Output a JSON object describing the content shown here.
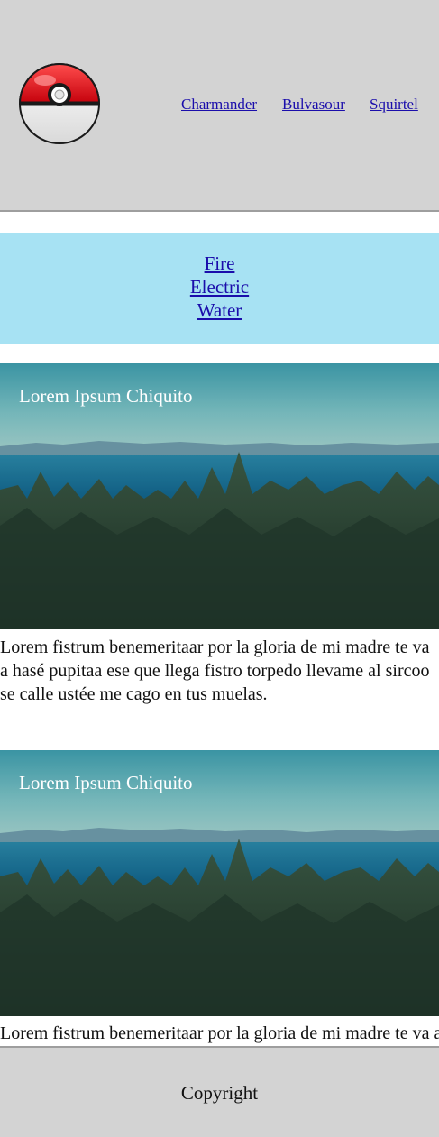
{
  "header": {
    "logo_icon": "pokeball-icon",
    "nav": [
      {
        "label": "Charmander"
      },
      {
        "label": "Bulvasour"
      },
      {
        "label": "Squirtel"
      }
    ]
  },
  "categories": [
    {
      "label": "Fire"
    },
    {
      "label": "Electric"
    },
    {
      "label": "Water"
    }
  ],
  "articles": [
    {
      "caption": "Lorem Ipsum Chiquito",
      "text": "Lorem fistrum benemeritaar por la gloria de mi madre te va a hasé pupitaa ese que llega fistro torpedo llevame al sircoo se calle ustée me cago en tus muelas."
    },
    {
      "caption": "Lorem Ipsum Chiquito",
      "text": "Lorem fistrum benemeritaar por la gloria de mi madre te va a hasé pupitaa ese que llega fistro torpedo llevame al sircoo se calle ustée me cago en tus muelas."
    }
  ],
  "footer": {
    "copyright": "Copyright"
  },
  "colors": {
    "header_bg": "#d3d3d3",
    "category_band_bg": "#a7e2f3",
    "link": "#1a0dab"
  }
}
